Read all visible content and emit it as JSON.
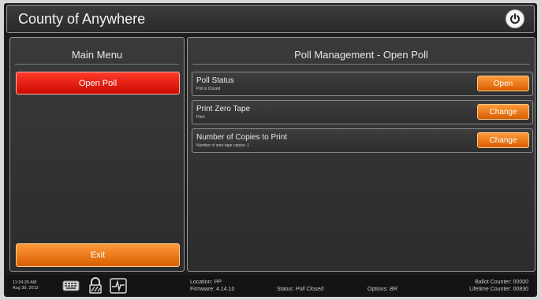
{
  "header": {
    "title": "County of Anywhere"
  },
  "left": {
    "title": "Main Menu",
    "open_poll_label": "Open Poll",
    "exit_label": "Exit"
  },
  "right": {
    "title": "Poll Management - Open Poll",
    "rows": [
      {
        "title": "Poll Status",
        "subtitle": "Poll is Closed",
        "button": "Open"
      },
      {
        "title": "Print Zero Tape",
        "subtitle": "Print",
        "button": "Change"
      },
      {
        "title": "Number of Copies to Print",
        "subtitle": "Number of zero tape copies: 1",
        "button": "Change"
      }
    ]
  },
  "status_bar": {
    "time": "11:24:26 AM",
    "date": "Aug 30, 2012",
    "location_label": "Location:",
    "location_value": "PP",
    "firmware_label": "Firmware:",
    "firmware_value": "4.14.10",
    "status_label": "Status:",
    "status_value": "Poll Closed",
    "options_label": "Options:",
    "options_value": "BR",
    "ballot_counter_label": "Ballot Counter:",
    "ballot_counter_value": "00000",
    "lifetime_counter_label": "Lifetime Counter:",
    "lifetime_counter_value": "00830"
  },
  "icons": [
    "power-icon",
    "keyboard-icon",
    "lock-icon",
    "heartbeat-icon"
  ],
  "colors": {
    "primary_red": "#e0190c",
    "accent_orange": "#f07a10",
    "background": "#2e2e2e"
  }
}
